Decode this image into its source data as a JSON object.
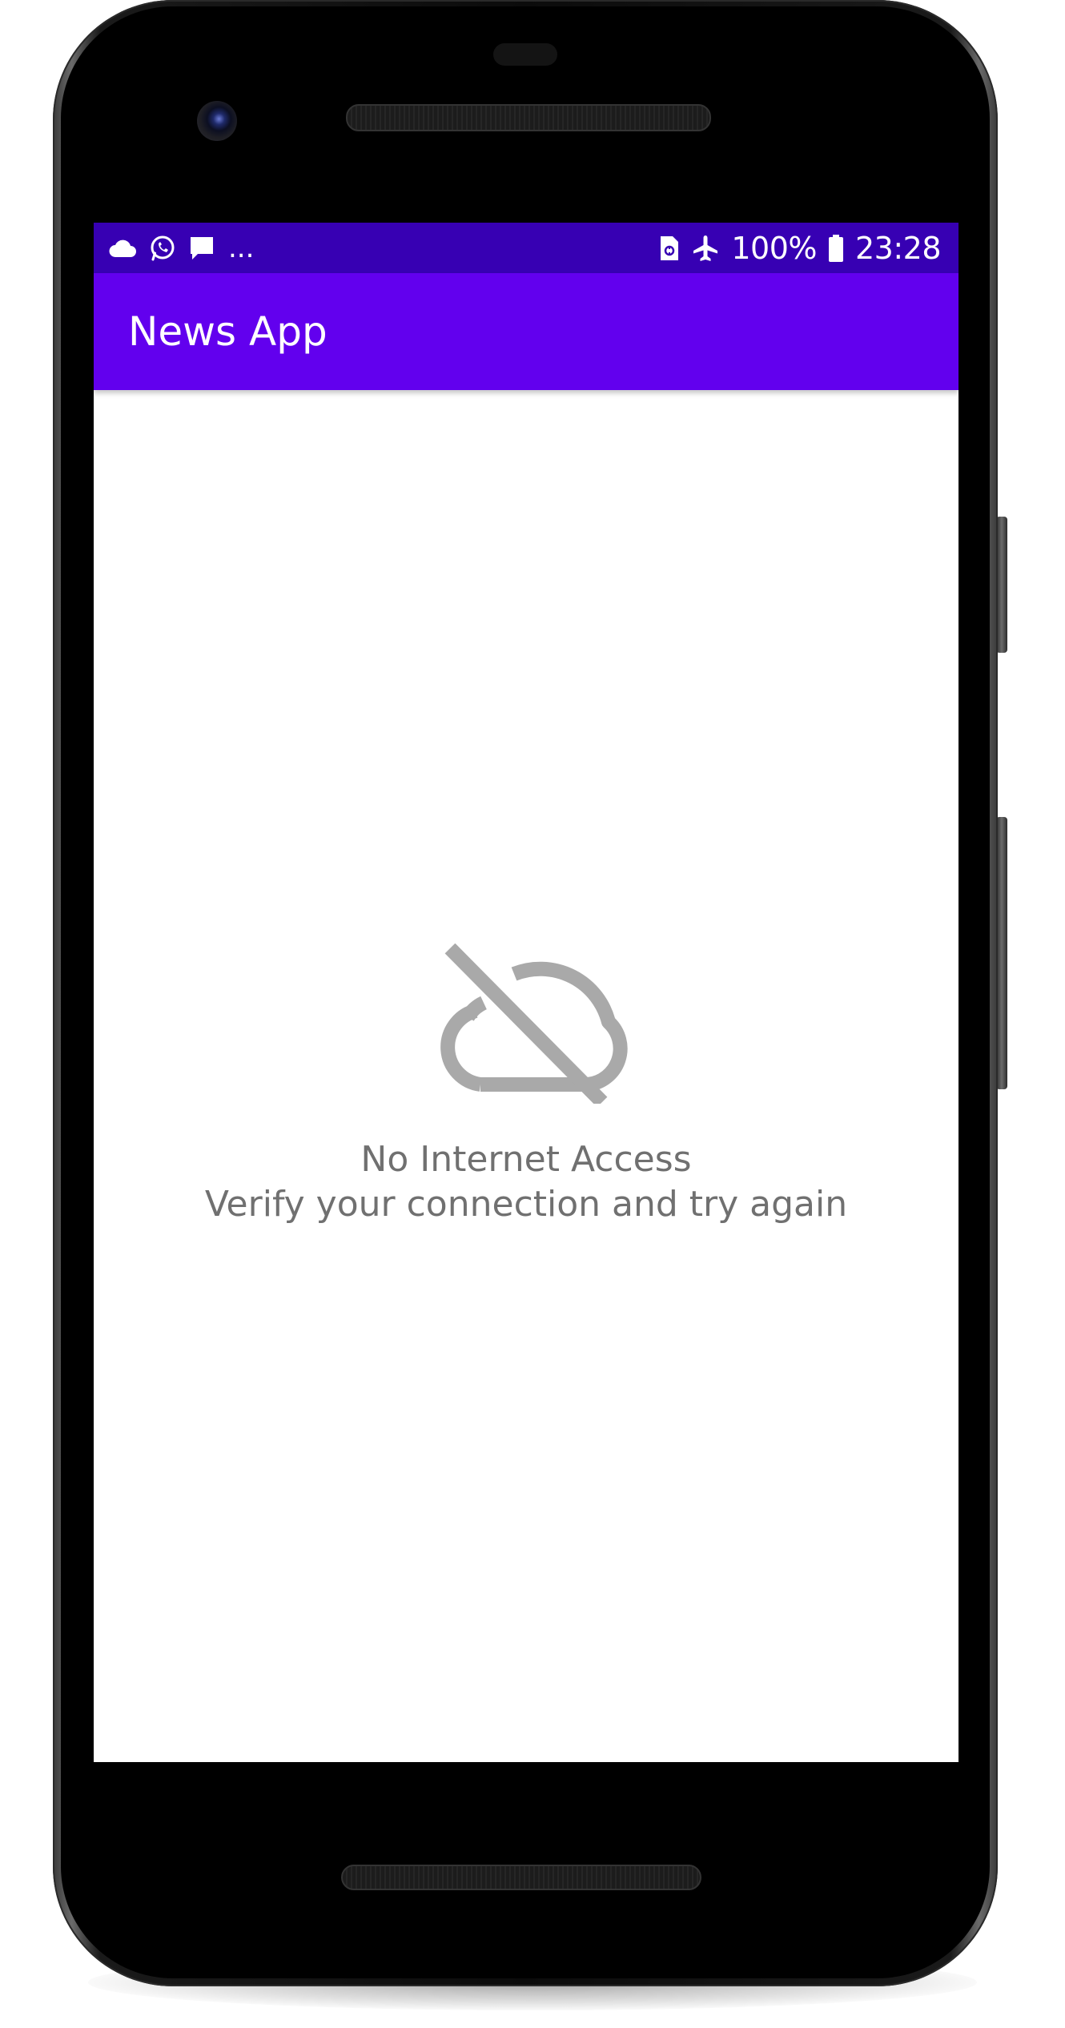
{
  "status_bar": {
    "left_icons": [
      "cloud-icon",
      "whatsapp-icon",
      "message-icon"
    ],
    "overflow": "...",
    "right_icons": [
      "sim-card-icon",
      "airplane-mode-icon",
      "battery-icon"
    ],
    "battery_percent": "100%",
    "time": "23:28"
  },
  "app_bar": {
    "title": "News App"
  },
  "empty_state": {
    "icon": "cloud-off-icon",
    "title": "No Internet Access",
    "subtitle": "Verify your connection and try again"
  },
  "colors": {
    "status_bar": "#3700b3",
    "app_bar": "#6200ee",
    "message_text": "#707070",
    "icon_gray": "#a9a9a9"
  }
}
